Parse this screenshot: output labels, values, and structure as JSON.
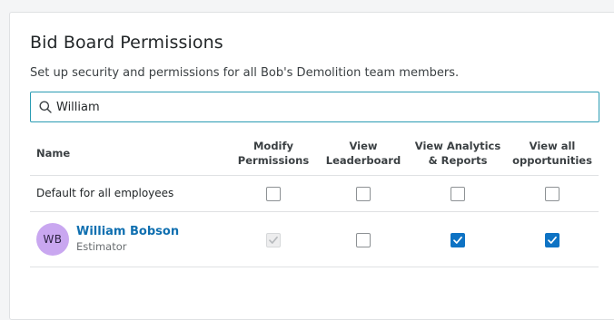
{
  "header": {
    "title": "Bid Board Permissions",
    "subtitle": "Set up security and permissions for all Bob's Demolition team members."
  },
  "search": {
    "value": "William",
    "icon": "search-icon"
  },
  "table": {
    "columns": {
      "name": "Name",
      "modify": [
        "Modify",
        "Permissions"
      ],
      "leaderboard": [
        "View",
        "Leaderboard"
      ],
      "analytics": [
        "View Analytics",
        "& Reports"
      ],
      "opportunities": [
        "View all",
        "opportunities"
      ]
    },
    "rows": [
      {
        "label": "Default for all employees",
        "modify": false,
        "leaderboard": false,
        "analytics": false,
        "opportunities": false
      },
      {
        "initials": "WB",
        "name": "William Bobson",
        "role": "Estimator",
        "modify": true,
        "modify_disabled": true,
        "leaderboard": false,
        "analytics": true,
        "opportunities": true
      }
    ]
  },
  "colors": {
    "accent": "#0e73c4",
    "link": "#0f6fb0",
    "search_border": "#2a9bb3",
    "avatar_bg": "#c9a7f0"
  }
}
